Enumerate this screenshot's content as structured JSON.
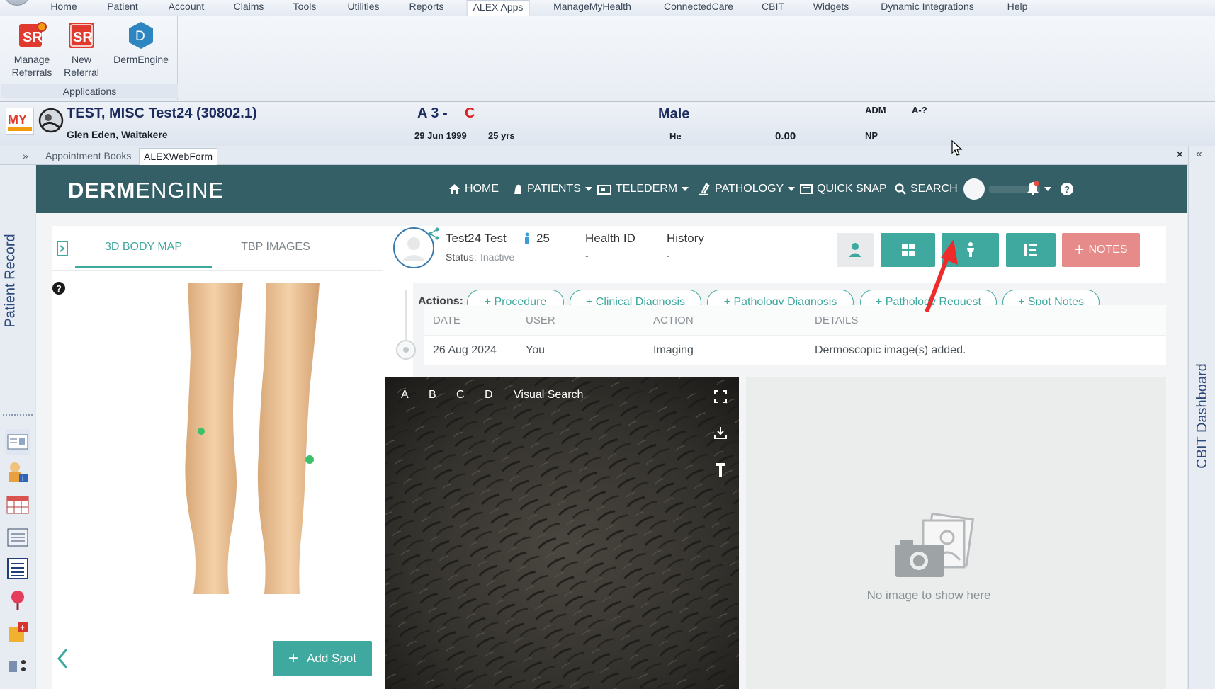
{
  "menu": {
    "items": [
      "Home",
      "Patient",
      "Account",
      "Claims",
      "Tools",
      "Utilities",
      "Reports",
      "ALEX Apps",
      "ManageMyHealth",
      "ConnectedCare",
      "CBIT",
      "Widgets",
      "Dynamic Integrations",
      "Help"
    ],
    "active": "ALEX Apps"
  },
  "ribbon": {
    "buttons": [
      {
        "line1": "Manage",
        "line2": "Referrals",
        "icon": "sr-referrals-icon"
      },
      {
        "line1": "New",
        "line2": "Referral",
        "icon": "sr-new-referral-icon"
      },
      {
        "line1": "DermEngine",
        "line2": "",
        "icon": "dermengine-icon"
      }
    ],
    "group_label": "Applications"
  },
  "banner": {
    "name": "TEST, MISC Test24 (30802.1)",
    "address": "Glen Eden, Waitakere",
    "code_a": "A 3 -",
    "code_c": "C",
    "dob": "29 Jun 1999",
    "age": "25 yrs",
    "gender": "Male",
    "he": "He",
    "balance": "0.00",
    "adm": "ADM",
    "a_q": "A-?",
    "np": "NP"
  },
  "tabs": {
    "items": [
      "Appointment Books",
      "ALEXWebForm"
    ],
    "active": "ALEXWebForm",
    "expand_left": "»",
    "expand_right": "«",
    "close": "×"
  },
  "rails": {
    "left_label": "Patient Record",
    "right_label": "CBIT Dashboard"
  },
  "dermengine": {
    "brand_bold": "DERM",
    "brand_light": "ENGINE",
    "nav": {
      "home": "HOME",
      "patients": "PATIENTS",
      "telederm": "TELEDERM",
      "pathology": "PATHOLOGY",
      "quick_snap": "QUICK SNAP",
      "search": "SEARCH"
    },
    "bodymap": {
      "tab_3d": "3D BODY MAP",
      "tab_tbp": "TBP IMAGES",
      "add_spot": "Add Spot"
    },
    "patient": {
      "name": "Test24 Test",
      "age": "25",
      "status_label": "Status:",
      "status": "Inactive",
      "health_id_label": "Health ID",
      "health_id": "-",
      "history_label": "History",
      "history": "-",
      "notes": "NOTES"
    },
    "actions": {
      "label": "Actions:",
      "items": [
        "+ Procedure",
        "+ Clinical Diagnosis",
        "+ Pathology Diagnosis",
        "+ Pathology Request",
        "+ Spot Notes"
      ]
    },
    "history_table": {
      "columns": [
        "DATE",
        "USER",
        "ACTION",
        "DETAILS"
      ],
      "rows": [
        {
          "date": "26 Aug 2024",
          "user": "You",
          "action": "Imaging",
          "details": "Dermoscopic image(s) added."
        }
      ]
    },
    "viewer": {
      "labels": [
        "A",
        "B",
        "C",
        "D"
      ],
      "visual_search": "Visual Search"
    },
    "empty_image": "No image to show here"
  },
  "colors": {
    "teal_dark": "#345f66",
    "teal": "#3fa89f",
    "notes_red": "#e68a8a",
    "arrow_red": "#ee2a2a"
  }
}
